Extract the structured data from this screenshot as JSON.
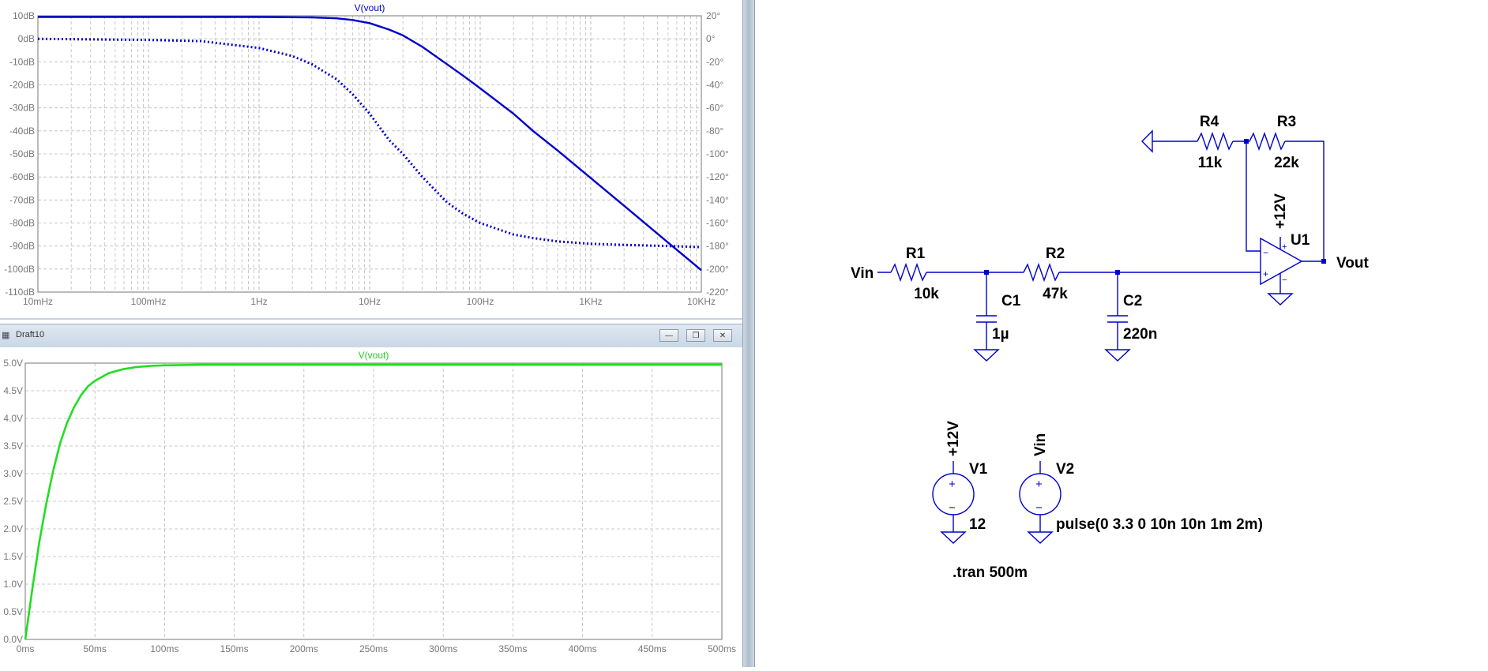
{
  "bode_plot": {
    "trace_label": "V(vout)",
    "left_axis_labels": [
      "10dB",
      "0dB",
      "-10dB",
      "-20dB",
      "-30dB",
      "-40dB",
      "-50dB",
      "-60dB",
      "-70dB",
      "-80dB",
      "-90dB",
      "-100dB",
      "-110dB"
    ],
    "right_axis_labels": [
      "20°",
      "0°",
      "-20°",
      "-40°",
      "-60°",
      "-80°",
      "-100°",
      "-120°",
      "-140°",
      "-160°",
      "-180°",
      "-200°",
      "-220°"
    ],
    "x_axis_labels": [
      "10mHz",
      "100mHz",
      "1Hz",
      "10Hz",
      "100Hz",
      "1KHz",
      "10KHz"
    ],
    "trace_color": "#0000cc"
  },
  "transient_window": {
    "title": "Draft10",
    "minimize_label": "—",
    "restore_label": "❐",
    "close_label": "✕"
  },
  "transient_plot": {
    "trace_label": "V(vout)",
    "y_axis_labels": [
      "5.0V",
      "4.5V",
      "4.0V",
      "3.5V",
      "3.0V",
      "2.5V",
      "2.0V",
      "1.5V",
      "1.0V",
      "0.5V",
      "0.0V"
    ],
    "x_axis_labels": [
      "0ms",
      "50ms",
      "100ms",
      "150ms",
      "200ms",
      "250ms",
      "300ms",
      "350ms",
      "400ms",
      "450ms",
      "500ms"
    ],
    "trace_color": "#22dd22"
  },
  "chart_data": [
    {
      "type": "line",
      "title": "V(vout)",
      "x_scale": "log",
      "xlim": [
        0.01,
        10000
      ],
      "ylim": [
        -110,
        10
      ],
      "y2lim": [
        -220,
        20
      ],
      "x": [
        0.01,
        0.1,
        0.3,
        1,
        2,
        3,
        5,
        7,
        10,
        15,
        20,
        30,
        50,
        70,
        100,
        200,
        300,
        500,
        1000,
        2000,
        5000,
        10000
      ],
      "series": [
        {
          "style": "solid",
          "axis": "magnitude",
          "values": [
            9.5,
            9.5,
            9.5,
            9.5,
            9.4,
            9.3,
            8.9,
            8.2,
            6.8,
            4.0,
            1.5,
            -3.5,
            -11,
            -16,
            -21.5,
            -32.5,
            -40,
            -48.5,
            -60.5,
            -72.5,
            -88.5,
            -100.5
          ]
        },
        {
          "style": "dotted",
          "axis": "phase",
          "values": [
            0,
            -1,
            -2,
            -8,
            -15,
            -22,
            -35,
            -48,
            -65,
            -88,
            -100,
            -120,
            -142,
            -152,
            -160,
            -170,
            -173,
            -176,
            -178,
            -179,
            -180,
            -181
          ]
        }
      ],
      "grid": true
    },
    {
      "type": "line",
      "title": "V(vout)",
      "xlim": [
        0,
        500
      ],
      "ylim": [
        0,
        5
      ],
      "x": [
        0,
        5,
        10,
        15,
        20,
        25,
        30,
        35,
        40,
        45,
        50,
        60,
        70,
        80,
        90,
        100,
        125,
        150,
        200,
        300,
        400,
        500
      ],
      "series": [
        {
          "values": [
            0,
            0.9,
            1.75,
            2.45,
            3.05,
            3.55,
            3.92,
            4.2,
            4.42,
            4.58,
            4.68,
            4.82,
            4.89,
            4.93,
            4.95,
            4.96,
            4.97,
            4.97,
            4.97,
            4.97,
            4.97,
            4.97
          ]
        }
      ],
      "grid": true
    }
  ],
  "schematic": {
    "wire_color": "#0000cc",
    "labels": {
      "vin_port": "Vin",
      "vout_port": "Vout",
      "r1_name": "R1",
      "r1_value": "10k",
      "r2_name": "R2",
      "r2_value": "47k",
      "r3_name": "R3",
      "r3_value": "22k",
      "r4_name": "R4",
      "r4_value": "11k",
      "c1_name": "C1",
      "c1_value": "1µ",
      "c2_name": "C2",
      "c2_value": "220n",
      "u1_name": "U1",
      "u1_supply": "+12V",
      "opamp_minus": "−",
      "opamp_plus": "+",
      "v1_name": "V1",
      "v1_value": "12",
      "v1_net": "+12V",
      "v2_name": "V2",
      "v2_value": "pulse(0 3.3 0 10n 10n 1m 2m)",
      "v2_net": "Vin",
      "source_plus": "+",
      "source_minus": "−",
      "directive": ".tran 500m"
    }
  }
}
